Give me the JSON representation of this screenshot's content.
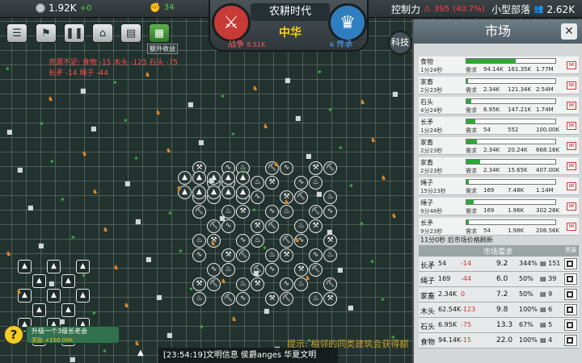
{
  "topbar": {
    "gold": "1.92K",
    "gold_delta": "+0",
    "strength": "34",
    "control_label": "控制力",
    "control_value": "395",
    "control_pct": "(40.7%)",
    "tribe_label": "小型部落",
    "population": "2.62K"
  },
  "era": {
    "title": "农耕时代",
    "civ": "中华",
    "war_label": "战争",
    "war_value": "8.51K",
    "legend_label": "传承",
    "legend_value": "6",
    "tech_label": "科技"
  },
  "alerts": {
    "line1": "资源不足: 食物 -15  木头 -123  石头 -75",
    "line2": "长矛 -14  绳子 -44",
    "extra_income": "额外收益"
  },
  "market": {
    "title": "市场",
    "demand_label": "需求",
    "rows": [
      {
        "name": "食物",
        "time": "1分24秒",
        "d1": "94.14K",
        "d2": "161.35K",
        "d3": "1.77M",
        "fill": 0.55
      },
      {
        "name": "家畜",
        "time": "2分23秒",
        "d1": "2.34K",
        "d2": "121.34K",
        "d3": "2.54M",
        "fill": 0.02
      },
      {
        "name": "石头",
        "time": "4分24秒",
        "d1": "6.95K",
        "d2": "147.21K",
        "d3": "1.74M",
        "fill": 0.05
      },
      {
        "name": "长矛",
        "time": "1分24秒",
        "d1": "54",
        "d2": "552",
        "d3": "100.00K",
        "fill": 0.1
      },
      {
        "name": "家畜",
        "time": "2分23秒",
        "d1": "2.34K",
        "d2": "20.24K",
        "d3": "668.16K",
        "fill": 0.12
      },
      {
        "name": "家畜",
        "time": "2分23秒",
        "d1": "2.34K",
        "d2": "15.65K",
        "d3": "407.00K",
        "fill": 0.15
      },
      {
        "name": "绳子",
        "time": "15分23秒",
        "d1": "169",
        "d2": "7.48K",
        "d3": "1.14M",
        "fill": 0.03
      },
      {
        "name": "绳子",
        "time": "9分48秒",
        "d1": "169",
        "d2": "1.96K",
        "d3": "302.28K",
        "fill": 0.08
      },
      {
        "name": "长矛",
        "time": "9分23秒",
        "d1": "54",
        "d2": "1.98K",
        "d3": "208.56K",
        "fill": 0.03
      }
    ],
    "refresh": "11分0秒 后市场价格刷新",
    "demand_header": "市场需求",
    "res_header": "资源",
    "demand": [
      {
        "name": "长矛",
        "amt": "54",
        "chg": "-14",
        "mul": "9.2",
        "pct": "344%",
        "cnt": "151"
      },
      {
        "name": "绳子",
        "amt": "169",
        "chg": "-44",
        "mul": "6.0",
        "pct": "50%",
        "cnt": "39"
      },
      {
        "name": "家畜",
        "amt": "2.34K",
        "chg": "0",
        "mul": "7.2",
        "pct": "50%",
        "cnt": "9"
      },
      {
        "name": "木头",
        "amt": "62.54K",
        "chg": "-123",
        "mul": "9.8",
        "pct": "100%",
        "cnt": "6"
      },
      {
        "name": "石头",
        "amt": "6.95K",
        "chg": "-75",
        "mul": "13.3",
        "pct": "67%",
        "cnt": "5"
      },
      {
        "name": "食物",
        "amt": "94.14K",
        "chg": "-15",
        "mul": "22.0",
        "pct": "100%",
        "cnt": "4"
      }
    ]
  },
  "quest": {
    "title": "升级一个3级长老会",
    "reward": "奖励 +150.00K"
  },
  "log": "[23:54:19]文明信息  侯爵anges  华夏文明",
  "tip": "提示: 相邻的同类建筑会获得额"
}
